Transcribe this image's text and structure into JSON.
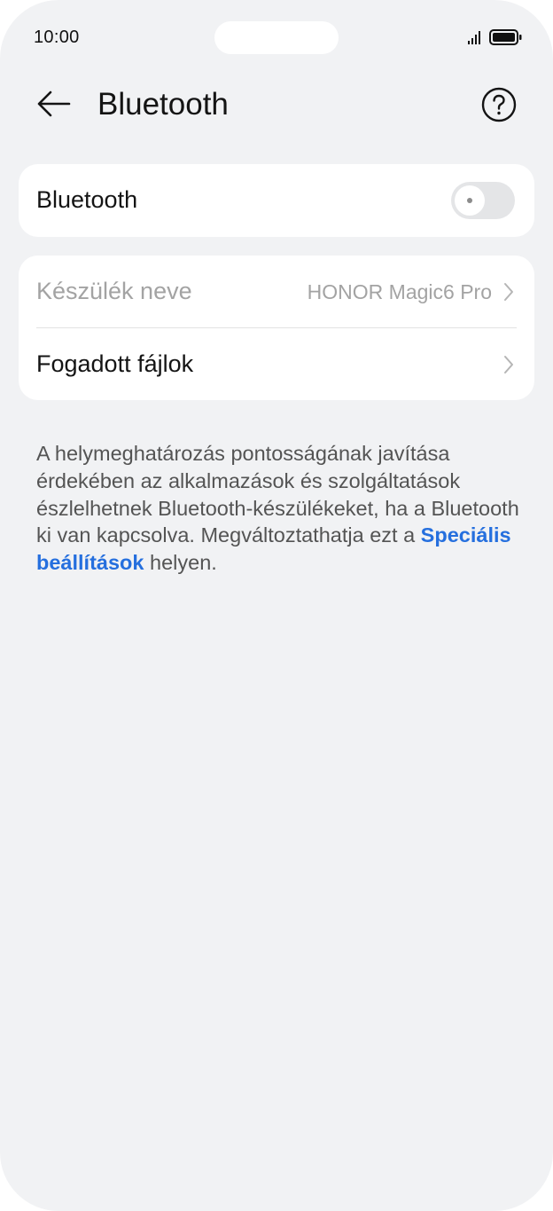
{
  "status_bar": {
    "time": "10:00"
  },
  "app_bar": {
    "title": "Bluetooth",
    "back_icon": "arrow-left-icon",
    "help_icon": "question-circle-icon"
  },
  "bluetooth_card": {
    "label": "Bluetooth",
    "toggle_on": false
  },
  "info_card": {
    "device_name_label": "Készülék neve",
    "device_name_value": "HONOR Magic6 Pro",
    "received_files_label": "Fogadott fájlok"
  },
  "description": {
    "text_before": "A helymeghatározás pontosságának javítása érdekében az alkalmazások és szolgáltatások észlelhetnek Bluetooth-készülékeket, ha a Bluetooth ki van kapcsolva. Megváltoztathatja ezt a ",
    "link_text": "Speciális beállítások",
    "text_after": " helyen."
  },
  "colors": {
    "background": "#f1f2f4",
    "card": "#ffffff",
    "link": "#256fde",
    "dim_text": "#a3a3a3"
  }
}
